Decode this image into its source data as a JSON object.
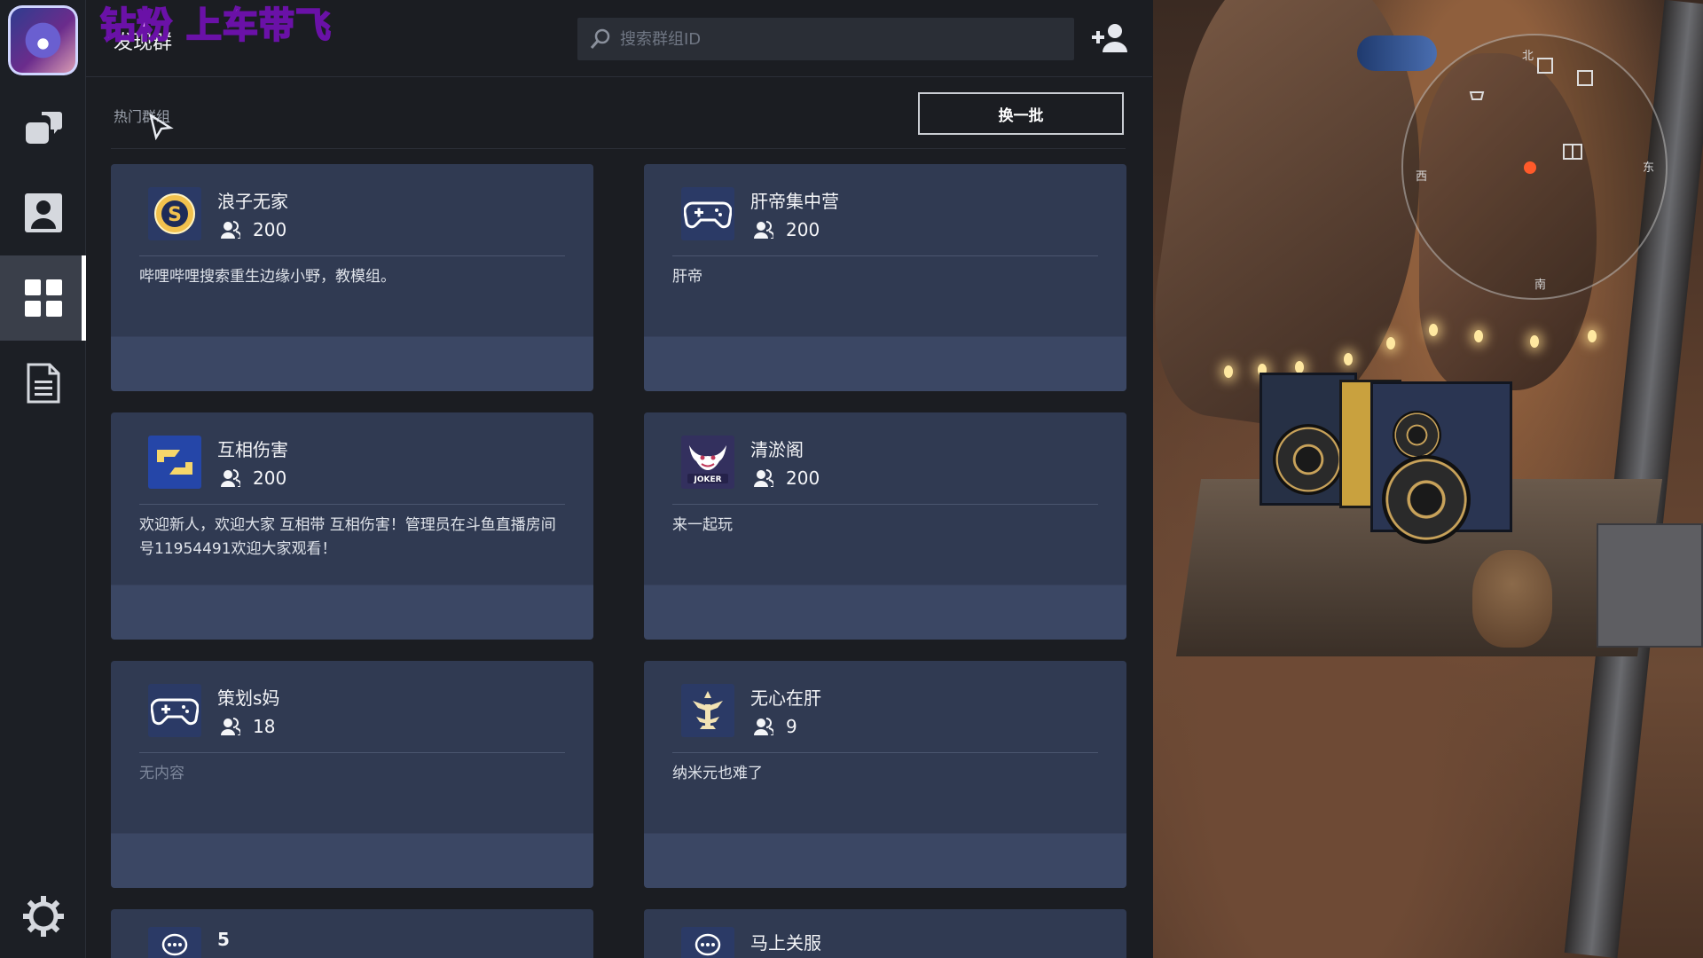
{
  "overlay_text": "钻粉 上车带飞",
  "page_title": "发现群",
  "search": {
    "placeholder": "搜索群组ID"
  },
  "section_label": "热门群组",
  "refresh_label": "换一批",
  "sidebar": {
    "items": [
      {
        "icon": "chat-icon",
        "active": false
      },
      {
        "icon": "contacts-icon",
        "active": false
      },
      {
        "icon": "grid-icon",
        "active": true
      },
      {
        "icon": "document-icon",
        "active": false
      }
    ],
    "settings_icon": "gear-icon"
  },
  "groups": [
    {
      "name": "浪子无家",
      "members": "200",
      "description": "哔哩哔哩搜索重生边缘小野，教模组。",
      "icon": "coin-icon"
    },
    {
      "name": "肝帝集中营",
      "members": "200",
      "description": "肝帝",
      "icon": "gamepad-icon"
    },
    {
      "name": "互相伤害",
      "members": "200",
      "description": "欢迎新人，欢迎大家 互相带 互相伤害！管理员在斗鱼直播房间号11954491欢迎大家观看！",
      "icon": "arrows-icon"
    },
    {
      "name": "清淤阁",
      "members": "200",
      "description": "来一起玩",
      "icon": "joker-icon"
    },
    {
      "name": "策划s妈",
      "members": "18",
      "description": "无内容",
      "icon": "gamepad-icon"
    },
    {
      "name": "无心在肝",
      "members": "9",
      "description": "纳米元也难了",
      "icon": "emblem-icon"
    },
    {
      "name": "5",
      "icon": "chat-bubble-icon"
    },
    {
      "name": "马上关服",
      "icon": "chat-bubble-icon"
    }
  ],
  "minimap": {
    "north_label": "北",
    "west_label": "西",
    "east_label": "东",
    "south_label": "南"
  },
  "colors": {
    "card_bg": "#303a52",
    "card_footer": "#3b4764",
    "sidebar_active": "#3a3f4a",
    "overlay": "#e9a3ff"
  }
}
